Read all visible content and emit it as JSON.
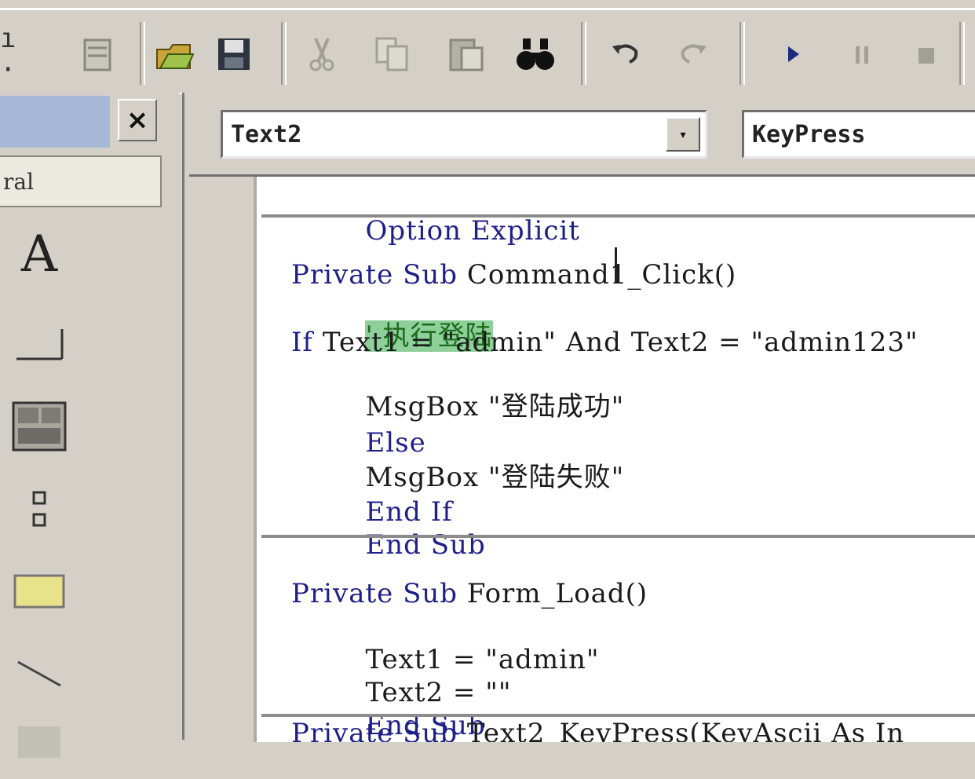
{
  "toolbar": {
    "buttons": [
      {
        "name": "add-form-icon",
        "label": "ı ·"
      },
      {
        "name": "menu-editor-icon"
      },
      {
        "name": "open-project-icon"
      },
      {
        "name": "save-project-icon"
      },
      {
        "name": "cut-icon"
      },
      {
        "name": "copy-icon"
      },
      {
        "name": "paste-icon"
      },
      {
        "name": "find-icon"
      },
      {
        "name": "undo-icon"
      },
      {
        "name": "redo-icon"
      },
      {
        "name": "run-icon"
      },
      {
        "name": "pause-icon"
      },
      {
        "name": "stop-icon"
      }
    ]
  },
  "toolbox": {
    "close_label": "×",
    "tab_label": "ral",
    "tools": [
      {
        "name": "label-tool-icon",
        "glyph": "A"
      },
      {
        "name": "textbox-tool-icon"
      },
      {
        "name": "command-button-tool-icon"
      },
      {
        "name": "checkbox-tool-icon"
      },
      {
        "name": "frame-tool-icon"
      },
      {
        "name": "line-tool-icon"
      },
      {
        "name": "shape-tool-icon"
      }
    ]
  },
  "code_window": {
    "object_combo": "Text2",
    "procedure_combo": "KeyPress",
    "lines": [
      {
        "text": "Option Explicit"
      },
      {
        "pre": "Private Sub ",
        "rest": "Command1_Click()"
      },
      {
        "comment": "' 执行登陆"
      },
      {
        "pre": "If ",
        "rest": "Text1 = \"admin\" And Text2 = \"admin123\""
      },
      {
        "text": "MsgBox \"登陆成功\""
      },
      {
        "text": "Else"
      },
      {
        "text": "MsgBox \"登陆失败\""
      },
      {
        "text": "End If"
      },
      {
        "text": "End Sub"
      },
      {
        "pre": "Private Sub ",
        "rest": "Form_Load()"
      },
      {
        "text": "Text1 = \"admin\""
      },
      {
        "text": "Text2 = \"\""
      },
      {
        "text": "End Sub"
      },
      {
        "pre": "Private Sub ",
        "rest": "Text2_KeyPress(KeyAscii As In"
      }
    ]
  }
}
